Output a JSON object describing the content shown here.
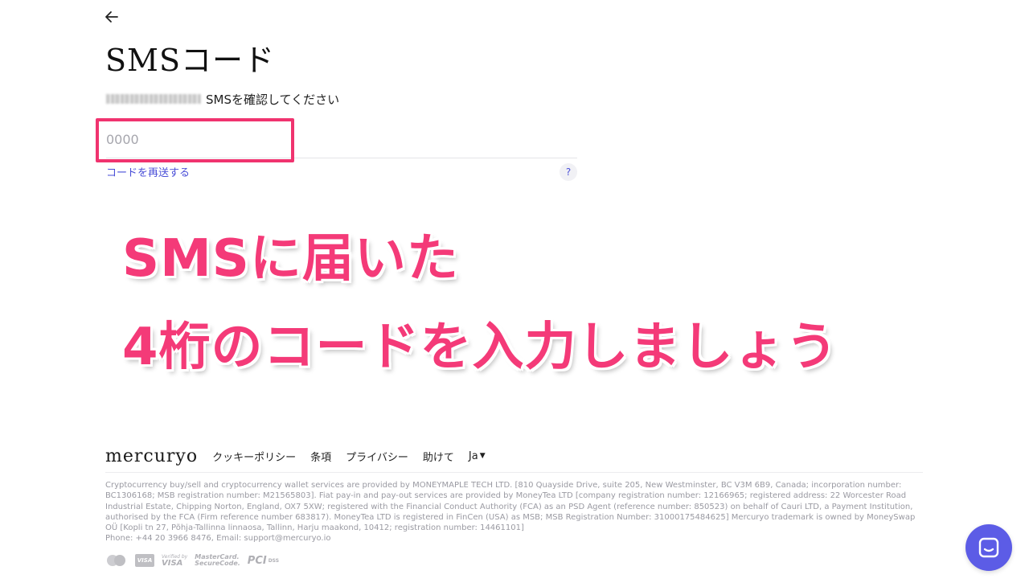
{
  "header": {
    "title": "SMSコード",
    "subtitle": "SMSを確認してください"
  },
  "form": {
    "code_placeholder": "0000",
    "code_value": "",
    "resend_label": "コードを再送する",
    "help_label": "?"
  },
  "annotation": {
    "line1": "SMSに届いた",
    "line2": "4桁のコードを入力しましょう",
    "color": "#f43a78"
  },
  "footer": {
    "logo": "mercuryo",
    "links": [
      "クッキーポリシー",
      "条項",
      "プライバシー",
      "助けて"
    ],
    "language": "Ja",
    "legal": "Cryptocurrency buy/sell and cryptocurrency wallet services are provided by MONEYMAPLE TECH LTD. [810 Quayside Drive, suite 205, New Westminster, BC V3M 6B9, Canada; incorporation number: BC1306168; MSB registration number: M21565803]. Fiat pay-in and pay-out services are provided by MoneyTea LTD [company registration number: 12166965; registered address: 22 Worcester Road Industrial Estate, Chipping Norton, England, OX7 5XW; registered with the Financial Conduct Authority (FCA) as an PSD Agent (reference number: 850523) on behalf of Cauri LTD, a Payment Institution, authorised by the FCA (Firm reference number 683817). MoneyTea LTD is registered in FinCen (USA) as MSB; MSB Registration Number: 31000175484625] Mercuryo trademark is owned by MoneySwap OÜ [Kopli tn 27, Põhja-Tallinna linnaosa, Tallinn, Harju maakond, 10412; registration number: 14461101]",
    "contact": "Phone: +44 20 3966 8476, Email: support@mercuryo.io",
    "badges": {
      "visa": "VISA",
      "verified_by": "Verified by",
      "verified_visa": "VISA",
      "mastercard": "MasterCard.",
      "securecode": "SecureCode.",
      "pci": "PCI",
      "dss": "DSS"
    }
  },
  "colors": {
    "accent": "#4a4fd8",
    "highlight": "#f0336f",
    "chat": "#5c5ce6"
  }
}
